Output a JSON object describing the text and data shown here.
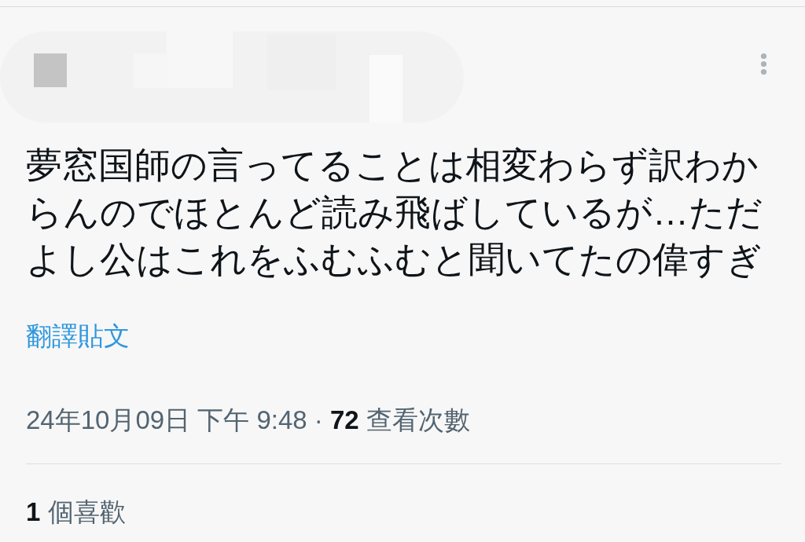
{
  "post": {
    "text": "夢窓国師の言ってることは相変わらず訳わからんのでほとんど読み飛ばしているが…ただよし公はこれをふむふむと聞いてたの偉すぎ",
    "translate_link": "翻譯貼文",
    "meta": "24年10月09日 下午 9:48 · **72** 查看次數",
    "likes": "**1** 個喜歡"
  }
}
